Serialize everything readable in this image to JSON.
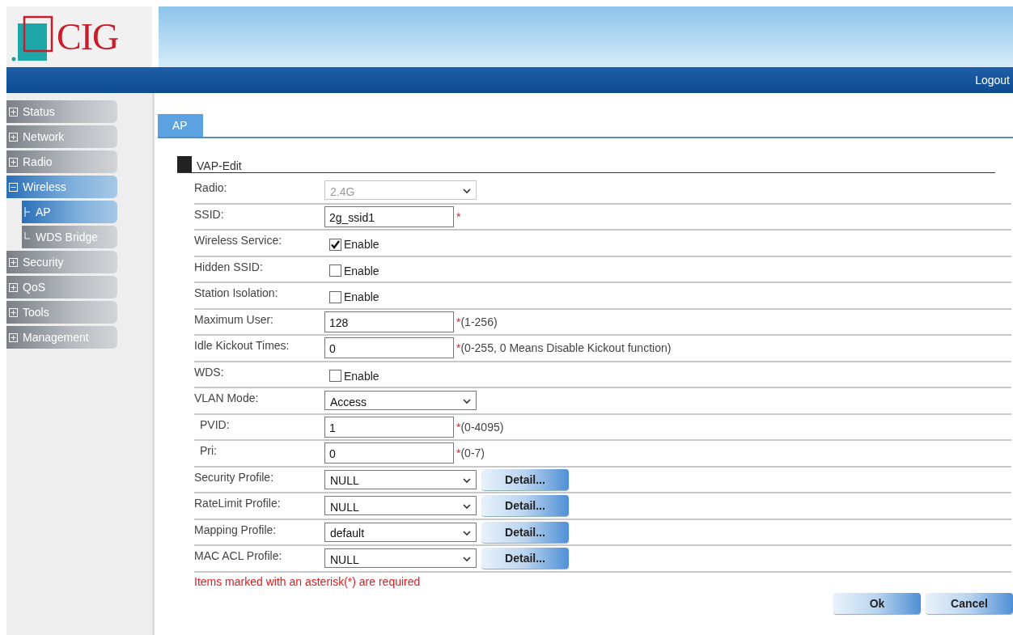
{
  "header": {
    "logo_text": "CIG",
    "logout": "Logout"
  },
  "sidebar": {
    "items": [
      {
        "label": "Status",
        "expanded": false,
        "selected": false
      },
      {
        "label": "Network",
        "expanded": false,
        "selected": false
      },
      {
        "label": "Radio",
        "expanded": false,
        "selected": false
      },
      {
        "label": "Wireless",
        "expanded": true,
        "selected": true,
        "children": [
          {
            "label": "AP",
            "selected": true
          },
          {
            "label": "WDS Bridge",
            "selected": false
          }
        ]
      },
      {
        "label": "Security",
        "expanded": false,
        "selected": false
      },
      {
        "label": "QoS",
        "expanded": false,
        "selected": false
      },
      {
        "label": "Tools",
        "expanded": false,
        "selected": false
      },
      {
        "label": "Management",
        "expanded": false,
        "selected": false
      }
    ]
  },
  "tabs": [
    {
      "label": "AP",
      "selected": true
    }
  ],
  "section_title": "VAP-Edit",
  "rows": [
    {
      "kind": "select",
      "label": "Radio:",
      "value": "2.4G",
      "disabled": true
    },
    {
      "kind": "text",
      "label": "SSID:",
      "value": "2g_ssid1",
      "mark": "*"
    },
    {
      "kind": "checkbox",
      "label": "Wireless Service:",
      "option": "Enable",
      "checked": true
    },
    {
      "kind": "checkbox",
      "label": "Hidden SSID:",
      "option": "Enable",
      "checked": false
    },
    {
      "kind": "checkbox",
      "label": "Station Isolation:",
      "option": "Enable",
      "checked": false
    },
    {
      "kind": "text",
      "label": "Maximum User:",
      "value": "128",
      "mark": "*",
      "hint": "(1-256)"
    },
    {
      "kind": "text",
      "label": "Idle Kickout Times:",
      "value": "0",
      "mark": "*",
      "hint": "(0-255, 0 Means Disable Kickout function)"
    },
    {
      "kind": "checkbox",
      "label": "WDS:",
      "option": "Enable",
      "checked": false
    },
    {
      "kind": "select",
      "label": "VLAN Mode:",
      "value": "Access",
      "disabled": false
    },
    {
      "kind": "text",
      "label": "PVID:",
      "value": "1",
      "mark": "*",
      "hint": "(0-4095)",
      "indented": true
    },
    {
      "kind": "text",
      "label": "Pri:",
      "value": "0",
      "mark": "*",
      "hint": "(0-7)",
      "indented": true
    },
    {
      "kind": "select",
      "label": "Security Profile:",
      "value": "NULL",
      "disabled": false,
      "button": "Detail..."
    },
    {
      "kind": "select",
      "label": "RateLimit Profile:",
      "value": "NULL",
      "disabled": false,
      "button": "Detail..."
    },
    {
      "kind": "select",
      "label": "Mapping Profile:",
      "value": "default",
      "disabled": false,
      "button": "Detail..."
    },
    {
      "kind": "select",
      "label": "MAC ACL Profile:",
      "value": "NULL",
      "disabled": false,
      "button": "Detail..."
    }
  ],
  "note": "Items marked with an asterisk(*) are required",
  "buttons": [
    "Ok",
    "Cancel"
  ]
}
